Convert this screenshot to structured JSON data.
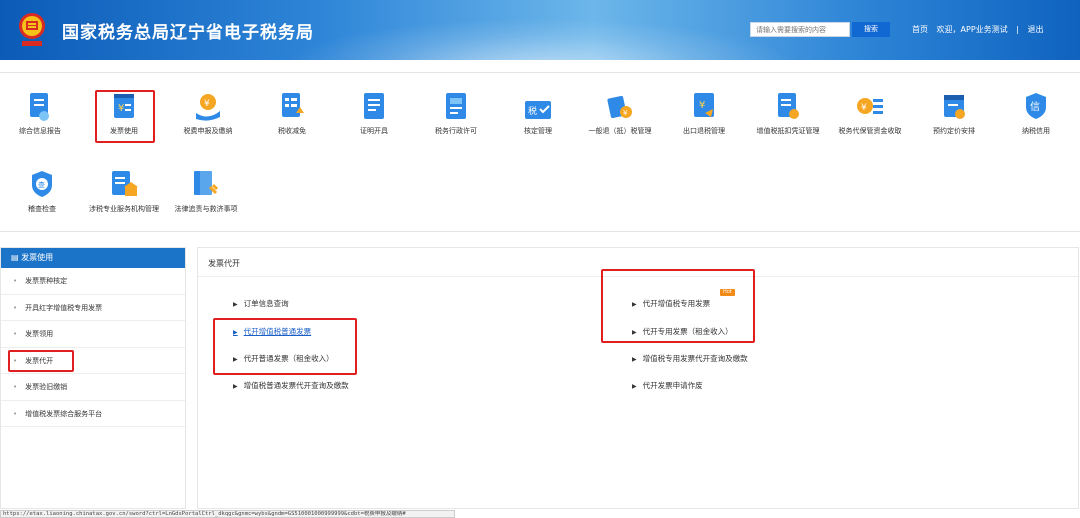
{
  "header": {
    "title": "国家税务总局辽宁省电子税务局",
    "search_placeholder": "请输入需要搜索的内容",
    "search_button": "搜索",
    "home": "首页",
    "welcome": "欢迎，APP业务测试",
    "separator": "|",
    "logout": "退出"
  },
  "menu": {
    "items": [
      {
        "label": "综合信息报告",
        "icon": "report-icon"
      },
      {
        "label": "发票使用",
        "icon": "invoice-icon"
      },
      {
        "label": "税费申报及缴纳",
        "icon": "tax-payment-icon"
      },
      {
        "label": "税收减免",
        "icon": "tax-reduction-icon"
      },
      {
        "label": "证明开具",
        "icon": "certificate-icon"
      },
      {
        "label": "税务行政许可",
        "icon": "license-icon"
      },
      {
        "label": "核定管理",
        "icon": "verification-icon"
      },
      {
        "label": "一般退（抵）税管理",
        "icon": "refund-icon"
      },
      {
        "label": "出口退税管理",
        "icon": "export-refund-icon"
      },
      {
        "label": "增值税抵扣凭证管理",
        "icon": "vat-deduction-icon"
      },
      {
        "label": "税务代保管资金收取",
        "icon": "custody-funds-icon"
      },
      {
        "label": "预约定价安排",
        "icon": "pricing-icon"
      },
      {
        "label": "纳税信用",
        "icon": "credit-icon"
      },
      {
        "label": "稽查检查",
        "icon": "inspection-icon"
      },
      {
        "label": "涉税专业服务机构管理",
        "icon": "agency-icon"
      },
      {
        "label": "法律追责与救济事项",
        "icon": "legal-icon"
      }
    ]
  },
  "sidebar": {
    "header": "发票使用",
    "items": [
      "发票票种核定",
      "开具红字增值税专用发票",
      "发票领用",
      "发票代开",
      "发票验旧缴销",
      "增值税发票综合服务平台"
    ]
  },
  "content": {
    "section_title": "发票代开",
    "left_links": [
      "订单信息查询",
      "代开增值税普通发票",
      "代开普通发票（租金收入）",
      "增值税普通发票代开查询及缴款"
    ],
    "right_links": [
      "代开增值税专用发票",
      "代开专用发票（租金收入）",
      "增值税专用发票代开查询及缴款",
      "代开发票申请作废"
    ],
    "hot_badge": "Hot"
  },
  "status_url": "https://etax.liaoning.chinatax.gov.cn/sword?ctrl=LnGdsPortalCtrl_dkqgc&gnmc=wybs&gndm=GS510001000999999&cdbt=税费申报及缴纳#",
  "colors": {
    "accent": "#1c74c9",
    "highlight": "#e02020",
    "header_dark": "#0b5bb7"
  }
}
